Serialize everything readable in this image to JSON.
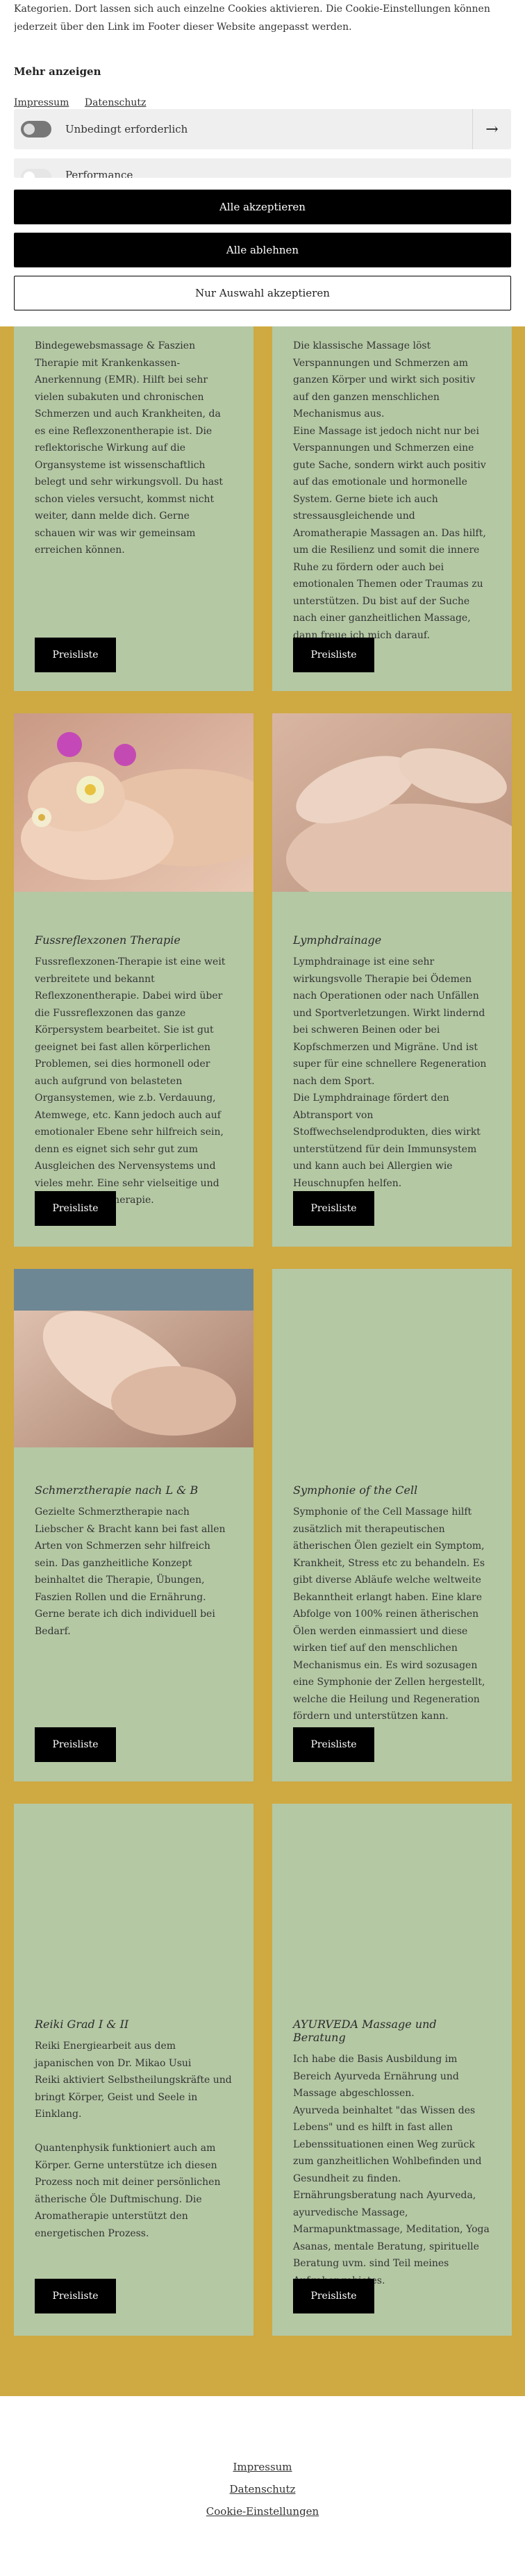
{
  "cookie_banner": {
    "intro": "Kategorien. Dort lassen sich auch einzelne Cookies aktivieren. Die Cookie-Einstellungen können jederzeit über den Link im Footer dieser Website angepasst werden.",
    "more_heading": "Mehr anzeigen",
    "links": {
      "impressum": "Impressum",
      "datenschutz": "Datenschutz"
    },
    "categories": [
      {
        "label": "Unbedingt erforderlich",
        "enabled": true
      },
      {
        "label": "Performance",
        "enabled": false
      }
    ],
    "accept_all": "Alle akzeptieren",
    "reject_all": "Alle ablehnen",
    "accept_selection": "Nur Auswahl akzeptieren"
  },
  "cards": [
    {
      "title": "",
      "text": "Bindegewebsmassage & Faszien Therapie mit Krankenkassen-Anerkennung (EMR). Hilft bei sehr vielen subakuten und chronischen Schmerzen und auch Krankheiten, da es eine Reflexzonentherapie ist. Die reflektorische Wirkung auf die Organsysteme ist wissenschaftlich belegt und sehr wirkungsvoll. Du hast schon vieles versucht, kommst nicht weiter, dann melde dich. Gerne schauen wir was wir gemeinsam erreichen können.",
      "button": "Preisliste"
    },
    {
      "title": "",
      "text": "Die klassische Massage löst Verspannungen und Schmerzen am ganzen Körper und wirkt sich positiv auf den ganzen menschlichen Mechanismus aus.\nEine Massage ist jedoch nicht nur bei Verspannungen und Schmerzen eine gute Sache, sondern wirkt auch positiv auf das emotionale und hormonelle System. Gerne biete ich auch stressausgleichende und Aromatherapie Massagen an. Das hilft, um die Resilienz und somit die innere Ruhe zu fördern oder auch bei emotionalen Themen oder Traumas zu unterstützen. Du bist auf der Suche nach einer ganzheitlichen Massage, dann freue ich mich darauf.",
      "button": "Preisliste"
    },
    {
      "title": "Fussreflexzonen Therapie",
      "text": " Fussreflexzonen-Therapie ist eine weit verbreitete und bekannt Reflexzonentherapie. Dabei wird über die Fussreflexzonen das ganze Körpersystem bearbeitet. Sie ist gut geeignet bei fast allen körperlichen Problemen, sei dies hormonell oder auch aufgrund von belasteten Organsystemen, wie z.b. Verdauung, Atemwege, etc. Kann jedoch auch auf emotionaler Ebene sehr hilfreich sein, denn es eignet sich sehr gut zum Ausgleichen des Nervensystems und vieles mehr. Eine sehr vielseitige und wirkungsvolle Therapie.",
      "button": "Preisliste"
    },
    {
      "title": "Lymphdrainage",
      "text": "Lymphdrainage ist eine sehr wirkungsvolle Therapie bei Ödemen nach Operationen oder nach Unfällen und Sportverletzungen. Wirkt lindernd bei schweren Beinen oder bei Kopfschmerzen und Migräne. Und ist super für eine schnellere Regeneration nach dem Sport.\nDie Lymphdrainage fördert den Abtransport von Stoffwechselendprodukten, dies wirkt unterstützend für dein Immunsystem und kann auch bei Allergien wie Heuschnupfen helfen.",
      "button": "Preisliste"
    },
    {
      "title": "Schmerztherapie nach L & B",
      "text": "Gezielte Schmerztherapie nach Liebscher & Bracht kann bei fast allen Arten von Schmerzen sehr hilfreich sein. Das ganzheitliche Konzept beinhaltet die Therapie, Übungen, Faszien Rollen und die Ernährung. Gerne berate ich dich individuell bei Bedarf.",
      "button": "Preisliste"
    },
    {
      "title": "Symphonie of the Cell",
      "text": "Symphonie of the Cell Massage hilft zusätzlich mit therapeutischen ätherischen Ölen gezielt ein Symptom, Krankheit, Stress etc zu behandeln. Es gibt diverse Abläufe welche weltweite Bekanntheit erlangt haben. Eine klare Abfolge von 100% reinen ätherischen Ölen werden einmassiert und diese wirken tief auf den menschlichen Mechanismus ein. Es wird sozusagen eine Symphonie der Zellen hergestellt, welche die Heilung und Regeneration fördern und unterstützen kann.",
      "button": "Preisliste"
    },
    {
      "title": "Reiki Grad I & II",
      "text": "Reiki Energiearbeit aus dem japanischen von Dr. Mikao Usui\nReiki aktiviert Selbstheilungskräfte und bringt Körper, Geist und Seele in Einklang.\n\nQuantenphysik funktioniert auch am Körper. Gerne unterstütze ich diesen Prozess noch mit deiner persönlichen ätherische Öle Duftmischung. Die Aromatherapie unterstützt den energetischen Prozess.",
      "button": "Preisliste"
    },
    {
      "title": "AYURVEDA Massage und Beratung",
      "text": "Ich habe die Basis Ausbildung im Bereich Ayurveda Ernährung und Massage abgeschlossen.\nAyurveda beinhaltet \"das Wissen des Lebens\" und es hilft in fast allen Lebenssituationen einen Weg zurück zum ganzheitlichen Wohlbefinden und Gesundheit zu finden.\nErnährungsberatung nach Ayurveda, ayurvedische Massage, Marmapunktmassage, Meditation, Yoga Asanas, mentale Beratung, spirituelle Beratung uvm. sind Teil meines Aufgabengebietes.",
      "button": "Preisliste"
    }
  ],
  "footer": {
    "impressum": "Impressum",
    "datenschutz": "Datenschutz",
    "cookie_settings": "Cookie-Einstellungen"
  },
  "colors": {
    "page_background": "#cfa942",
    "card_background": "#b4c8a4",
    "button": "#000000"
  }
}
